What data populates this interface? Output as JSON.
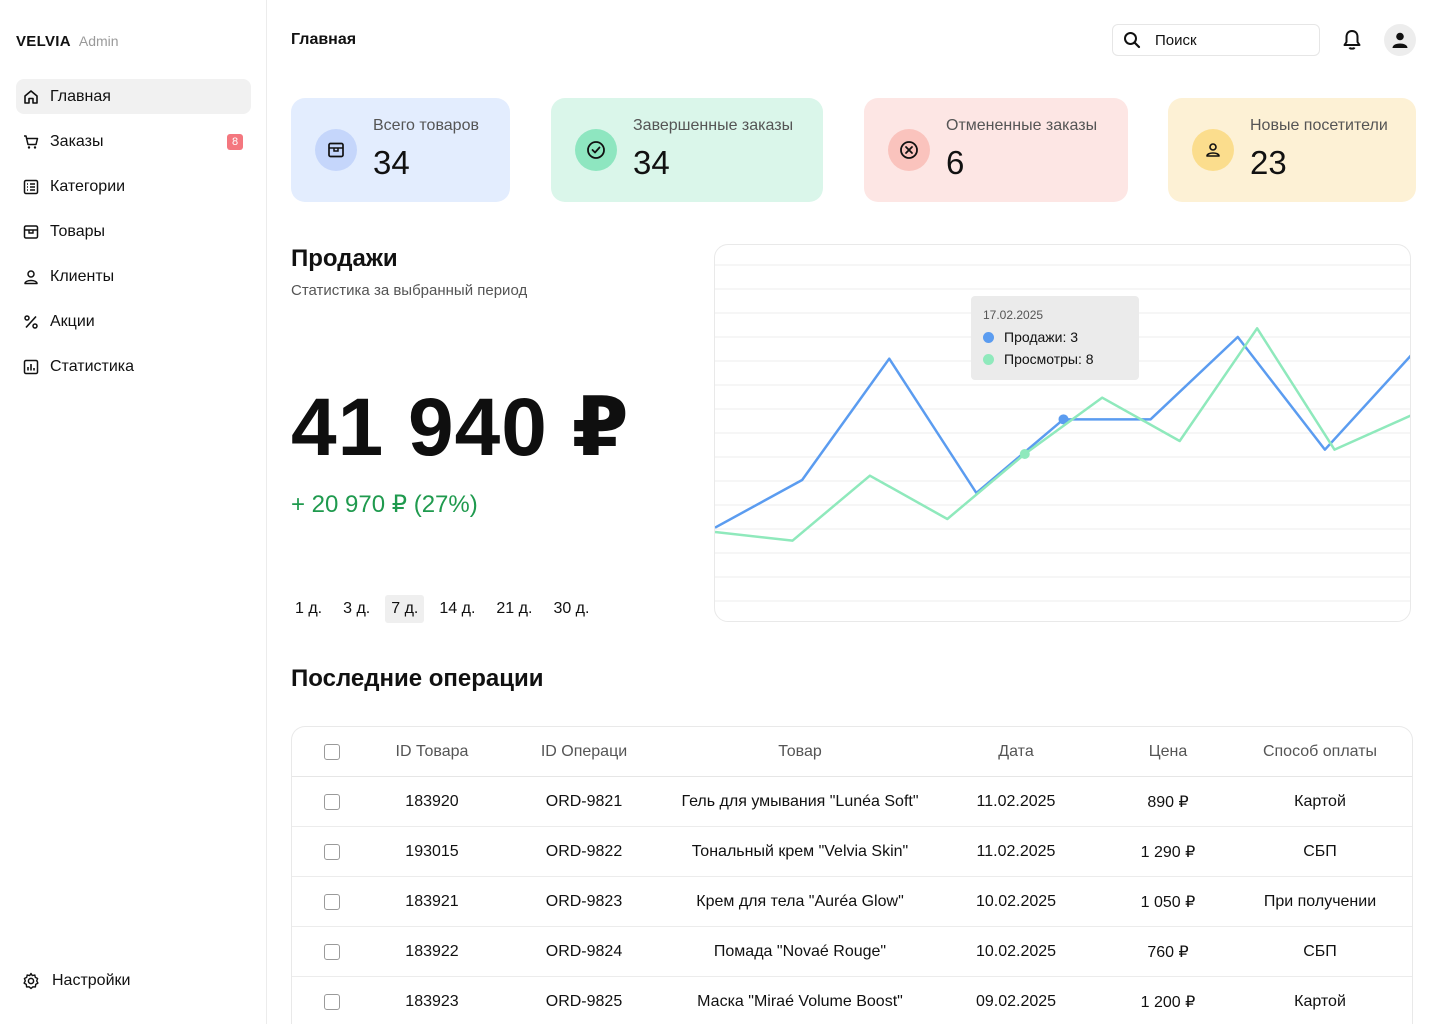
{
  "brand": {
    "name": "VELVIA",
    "sub": "Admin"
  },
  "sidebar": {
    "items": [
      {
        "label": "Главная",
        "icon": "home-icon",
        "active": true
      },
      {
        "label": "Заказы",
        "icon": "cart-icon",
        "badge": "8"
      },
      {
        "label": "Категории",
        "icon": "list-icon"
      },
      {
        "label": "Товары",
        "icon": "box-icon"
      },
      {
        "label": "Клиенты",
        "icon": "user-icon"
      },
      {
        "label": "Акции",
        "icon": "percent-icon"
      },
      {
        "label": "Статистика",
        "icon": "chart-icon"
      }
    ],
    "settings": {
      "label": "Настройки",
      "icon": "gear-icon"
    }
  },
  "header": {
    "title": "Главная",
    "search_placeholder": "Поиск"
  },
  "stats": [
    {
      "label": "Всего товаров",
      "value": "34",
      "bg": "#e3edfe",
      "icon_bg": "#c5d6fb",
      "icon": "box-icon"
    },
    {
      "label": "Завершенные заказы",
      "value": "34",
      "bg": "#daf6ea",
      "icon_bg": "#8ee6c0",
      "icon": "check-circle-icon"
    },
    {
      "label": "Отмененные заказы",
      "value": "6",
      "bg": "#fde6e4",
      "icon_bg": "#fac3bd",
      "icon": "x-circle-icon"
    },
    {
      "label": "Новые посетители",
      "value": "23",
      "bg": "#fdf1d5",
      "icon_bg": "#fbdd8d",
      "icon": "user-icon"
    }
  ],
  "sales": {
    "title": "Продажи",
    "subtitle": "Статистика за выбранный период",
    "amount": "41 940 ₽",
    "delta": "+ 20 970 ₽ (27%)",
    "periods": [
      "1 д.",
      "3 д.",
      "7 д.",
      "14 д.",
      "21 д.",
      "30 д."
    ],
    "active_period": "7 д."
  },
  "chart_data": {
    "type": "line",
    "series": [
      {
        "name": "Продажи",
        "color": "#5b9cf0",
        "values": [
          0.4,
          1.5,
          4.3,
          1.2,
          2.9,
          2.9,
          4.8,
          2.2,
          4.4
        ]
      },
      {
        "name": "Просмотры",
        "color": "#8fe9bc",
        "values": [
          0.3,
          0.1,
          1.6,
          0.6,
          2.1,
          3.4,
          2.4,
          5.0,
          2.2,
          3.0
        ]
      }
    ],
    "tooltip": {
      "date": "17.02.2025",
      "rows": [
        {
          "label": "Продажи: 3",
          "color": "#5b9cf0"
        },
        {
          "label": "Просмотры: 8",
          "color": "#8fe9bc"
        }
      ]
    },
    "grid": true
  },
  "operations": {
    "title": "Последние операции",
    "columns": [
      "ID Товара",
      "ID Операци",
      "Товар",
      "Дата",
      "Цена",
      "Способ оплаты"
    ],
    "rows": [
      [
        "183920",
        "ORD-9821",
        "Гель для умывания \"Lunéa Soft\"",
        "11.02.2025",
        "890 ₽",
        "Картой"
      ],
      [
        "193015",
        "ORD-9822",
        "Тональный крем \"Velvia Skin\"",
        "11.02.2025",
        "1 290 ₽",
        "СБП"
      ],
      [
        "183921",
        "ORD-9823",
        "Крем для тела \"Auréa Glow\"",
        "10.02.2025",
        "1 050 ₽",
        "При получении"
      ],
      [
        "183922",
        "ORD-9824",
        "Помада \"Novaé Rouge\"",
        "10.02.2025",
        "760 ₽",
        "СБП"
      ],
      [
        "183923",
        "ORD-9825",
        "Маска \"Miraé Volume Boost\"",
        "09.02.2025",
        "1 200 ₽",
        "Картой"
      ]
    ]
  }
}
